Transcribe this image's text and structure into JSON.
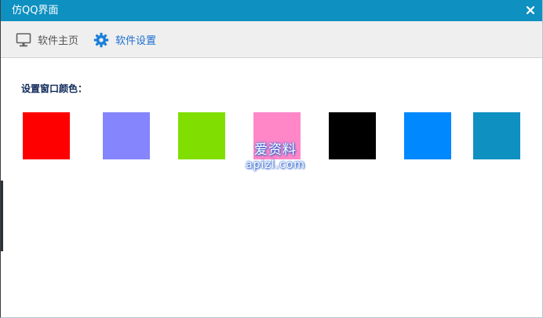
{
  "window": {
    "title": "仿QQ界面",
    "close_glyph": "✕",
    "accent_color": "#0e90c0"
  },
  "toolbar": {
    "tabs": [
      {
        "label": "软件主页",
        "icon": "monitor-icon",
        "active": false
      },
      {
        "label": "软件设置",
        "icon": "gear-icon",
        "active": true
      }
    ]
  },
  "settings": {
    "section_label": "设置窗口颜色：",
    "colors": [
      {
        "name": "red",
        "hex": "#ff0000"
      },
      {
        "name": "periwinkle",
        "hex": "#8585fe"
      },
      {
        "name": "green",
        "hex": "#80df00"
      },
      {
        "name": "pink",
        "hex": "#ff87c8"
      },
      {
        "name": "black",
        "hex": "#000000"
      },
      {
        "name": "azure",
        "hex": "#0088ff"
      },
      {
        "name": "teal-blue",
        "hex": "#0e90c0"
      }
    ]
  },
  "watermark": {
    "line1": "爱资料",
    "line2": "apizl.com"
  }
}
